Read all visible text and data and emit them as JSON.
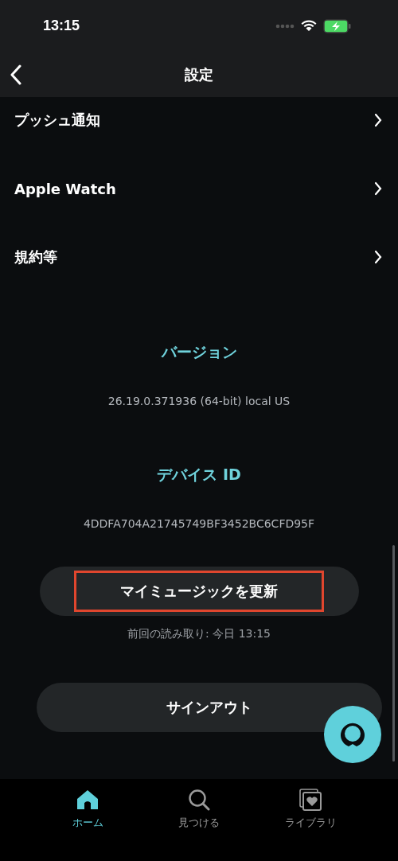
{
  "status_bar": {
    "time": "13:15"
  },
  "nav": {
    "title": "設定"
  },
  "settings": [
    {
      "label": "プッシュ通知"
    },
    {
      "label": "Apple Watch"
    },
    {
      "label": "規約等"
    }
  ],
  "version": {
    "heading": "バージョン",
    "value": "26.19.0.371936 (64-bit) local US"
  },
  "device": {
    "heading": "デバイス ID",
    "value": "4DDFA704A21745749BF3452BC6CFD95F"
  },
  "refresh": {
    "label": "マイミュージックを更新",
    "highlighted": true,
    "note": "前回の読み取り: 今日 13:15"
  },
  "signout": {
    "label": "サインアウト"
  },
  "tabs": [
    {
      "kind": "home",
      "label": "ホーム",
      "selected": true
    },
    {
      "kind": "search",
      "label": "見つける",
      "selected": false
    },
    {
      "kind": "library",
      "label": "ライブラリ",
      "selected": false
    }
  ]
}
